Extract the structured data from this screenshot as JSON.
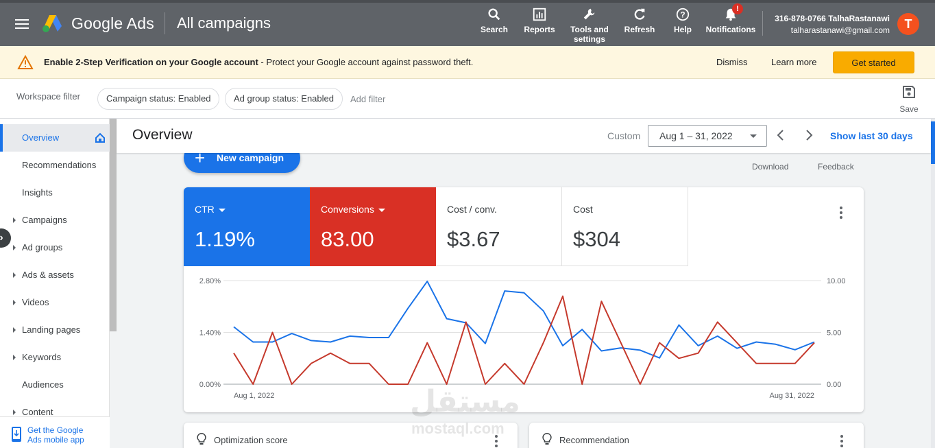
{
  "topbar": {
    "brand": "Google Ads",
    "page": "All campaigns",
    "actions": {
      "search": "Search",
      "reports": "Reports",
      "tools_line1": "Tools and",
      "tools_line2": "settings",
      "refresh": "Refresh",
      "help": "Help",
      "notifications": "Notifications"
    },
    "notification_badge": "!",
    "account_name": "316-878-0766 TalhaRastanawi",
    "account_email": "talharastanawi@gmail.com",
    "avatar_letter": "T",
    "avatar_color": "#f4511e"
  },
  "banner": {
    "bold_text": "Enable 2-Step Verification on your Google account",
    "rest_text": " - Protect your Google account against password theft.",
    "dismiss": "Dismiss",
    "learn_more": "Learn more",
    "get_started": "Get started"
  },
  "filterbar": {
    "label": "Workspace filter",
    "chips": [
      "Campaign status: Enabled",
      "Ad group status: Enabled"
    ],
    "add_filter": "Add filter",
    "save": "Save"
  },
  "sidebar": {
    "items": [
      {
        "label": "Overview",
        "active": true
      },
      {
        "label": "Recommendations"
      },
      {
        "label": "Insights"
      },
      {
        "label": "Campaigns",
        "caret": true
      },
      {
        "label": "Ad groups",
        "caret": true
      },
      {
        "label": "Ads & assets",
        "caret": true
      },
      {
        "label": "Videos",
        "caret": true
      },
      {
        "label": "Landing pages",
        "caret": true
      },
      {
        "label": "Keywords",
        "caret": true
      },
      {
        "label": "Audiences"
      },
      {
        "label": "Content",
        "caret": true
      }
    ],
    "mobile_line1": "Get the Google",
    "mobile_line2": "Ads mobile app"
  },
  "main": {
    "title": "Overview",
    "custom": "Custom",
    "date_range": "Aug 1 – 31, 2022",
    "show_last": "Show last 30 days",
    "new_campaign": "New campaign",
    "download": "Download",
    "feedback": "Feedback"
  },
  "metrics": [
    {
      "label": "CTR",
      "value": "1.19%",
      "selected": true,
      "color": "#1a73e8"
    },
    {
      "label": "Conversions",
      "value": "83.00",
      "selected": true,
      "color": "#d93025"
    },
    {
      "label": "Cost / conv.",
      "value": "$3.67"
    },
    {
      "label": "Cost",
      "value": "$304"
    }
  ],
  "chart_data": {
    "type": "line",
    "x_start_label": "Aug 1, 2022",
    "x_end_label": "Aug 31, 2022",
    "y_left_ticks": [
      "2.80%",
      "1.40%",
      "0.00%"
    ],
    "y_right_ticks": [
      "10.00",
      "5.00",
      "0.00"
    ],
    "y_left_range": [
      0,
      2.8
    ],
    "y_right_range": [
      0,
      10
    ],
    "grid": true,
    "series": [
      {
        "name": "CTR",
        "axis": "left",
        "color": "#1a73e8",
        "values": [
          1.55,
          1.14,
          1.14,
          1.37,
          1.18,
          1.14,
          1.3,
          1.26,
          1.26,
          2.05,
          2.78,
          1.77,
          1.66,
          1.1,
          2.52,
          2.47,
          1.98,
          1.04,
          1.48,
          0.9,
          0.98,
          0.92,
          0.71,
          1.6,
          1.04,
          1.3,
          0.97,
          1.14,
          1.08,
          0.93,
          1.14
        ]
      },
      {
        "name": "Conversions",
        "axis": "right",
        "color": "#c5392c",
        "values": [
          3.0,
          0.0,
          5.0,
          0.0,
          2.0,
          3.0,
          2.0,
          2.0,
          0.0,
          0.0,
          4.0,
          0.0,
          6.0,
          0.0,
          2.0,
          0.0,
          4.0,
          8.5,
          0.0,
          8.0,
          4.0,
          0.0,
          4.0,
          2.5,
          3.0,
          6.0,
          4.0,
          2.0,
          2.0,
          2.0,
          4.0
        ]
      }
    ]
  },
  "cards": {
    "optimization": "Optimization score",
    "recommendation": "Recommendation"
  },
  "watermark": {
    "arabic": "مستقل",
    "latin": "mostaql.com"
  }
}
